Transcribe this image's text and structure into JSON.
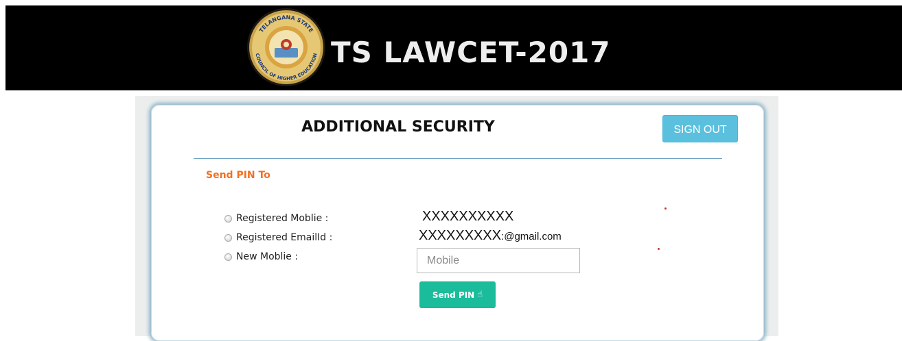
{
  "header": {
    "title": "TS LAWCET-2017",
    "logo_text_top": "TELANGANA STATE",
    "logo_text_bottom": "COUNCIL OF HIGHER EDUCATION"
  },
  "card": {
    "heading": "ADDITIONAL SECURITY",
    "signout_label": "SIGN OUT",
    "section_label": "Send PIN To",
    "options": [
      {
        "label": "Registered Moblie :",
        "value": "XXXXXXXXXX"
      },
      {
        "label": "Registered EmailId :",
        "value": "XXXXXXXXX",
        "suffix": ":@gmail.com"
      },
      {
        "label": "New Moblie :"
      }
    ],
    "mobile_placeholder": "Mobile",
    "sendpin_label": "Send PIN",
    "sendpin_icon": "hand-pointer-icon"
  },
  "colors": {
    "banner_bg": "#000000",
    "signout_bg": "#5bc0de",
    "section_label": "#f26f21",
    "sendpin_bg": "#1abc9c",
    "divider": "#6ea3c4"
  }
}
